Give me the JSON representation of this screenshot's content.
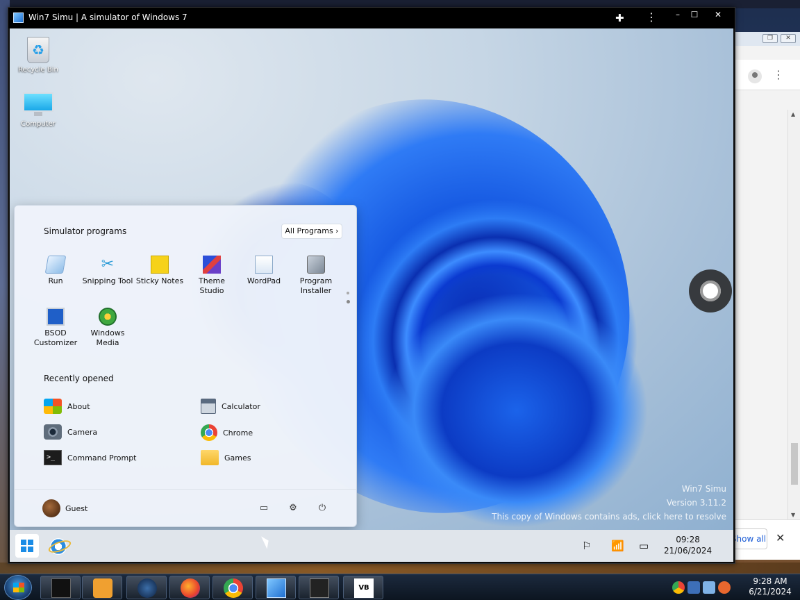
{
  "window": {
    "title": "Win7 Simu | A simulator of Windows 7",
    "buttons": {
      "minimize": "–",
      "maximize": "☐",
      "close": "✕"
    }
  },
  "desktop_icons": [
    {
      "label": "Recycle Bin",
      "icon": "recycle-bin-icon"
    },
    {
      "label": "Computer",
      "icon": "computer-icon"
    }
  ],
  "start_menu": {
    "pinned_heading": "Simulator programs",
    "all_programs_label": "All Programs",
    "pinned": [
      {
        "label": "Run",
        "icon": "run-icon"
      },
      {
        "label": "Snipping Tool",
        "icon": "snipping-tool-icon"
      },
      {
        "label": "Sticky Notes",
        "icon": "sticky-notes-icon"
      },
      {
        "label": "Theme Studio",
        "icon": "theme-studio-icon"
      },
      {
        "label": "WordPad",
        "icon": "wordpad-icon"
      },
      {
        "label": "Program Installer",
        "icon": "program-installer-icon"
      },
      {
        "label": "BSOD Customizer",
        "icon": "bsod-customizer-icon"
      },
      {
        "label": "Windows Media",
        "icon": "windows-media-icon"
      }
    ],
    "recent_heading": "Recently opened",
    "recent": [
      {
        "label": "About",
        "icon": "windows-logo-icon"
      },
      {
        "label": "Calculator",
        "icon": "calculator-icon"
      },
      {
        "label": "Camera",
        "icon": "camera-icon"
      },
      {
        "label": "Chrome",
        "icon": "chrome-icon"
      },
      {
        "label": "Command Prompt",
        "icon": "command-prompt-icon"
      },
      {
        "label": "Games",
        "icon": "games-folder-icon"
      }
    ],
    "user": "Guest"
  },
  "watermark": {
    "line1": "Win7 Simu",
    "line2": "Version 3.11.2",
    "line3": "This copy of Windows contains ads, click here to resolve"
  },
  "sim_taskbar": {
    "time": "09:28",
    "date": "21/06/2024"
  },
  "host": {
    "time": "9:28 AM",
    "date": "6/21/2024",
    "browser_show_all": "Show all"
  },
  "colors": {
    "accent": "#1a8ce6",
    "start_menu_bg": "#eef3fa",
    "taskbar_bg": "#e9eef5"
  }
}
